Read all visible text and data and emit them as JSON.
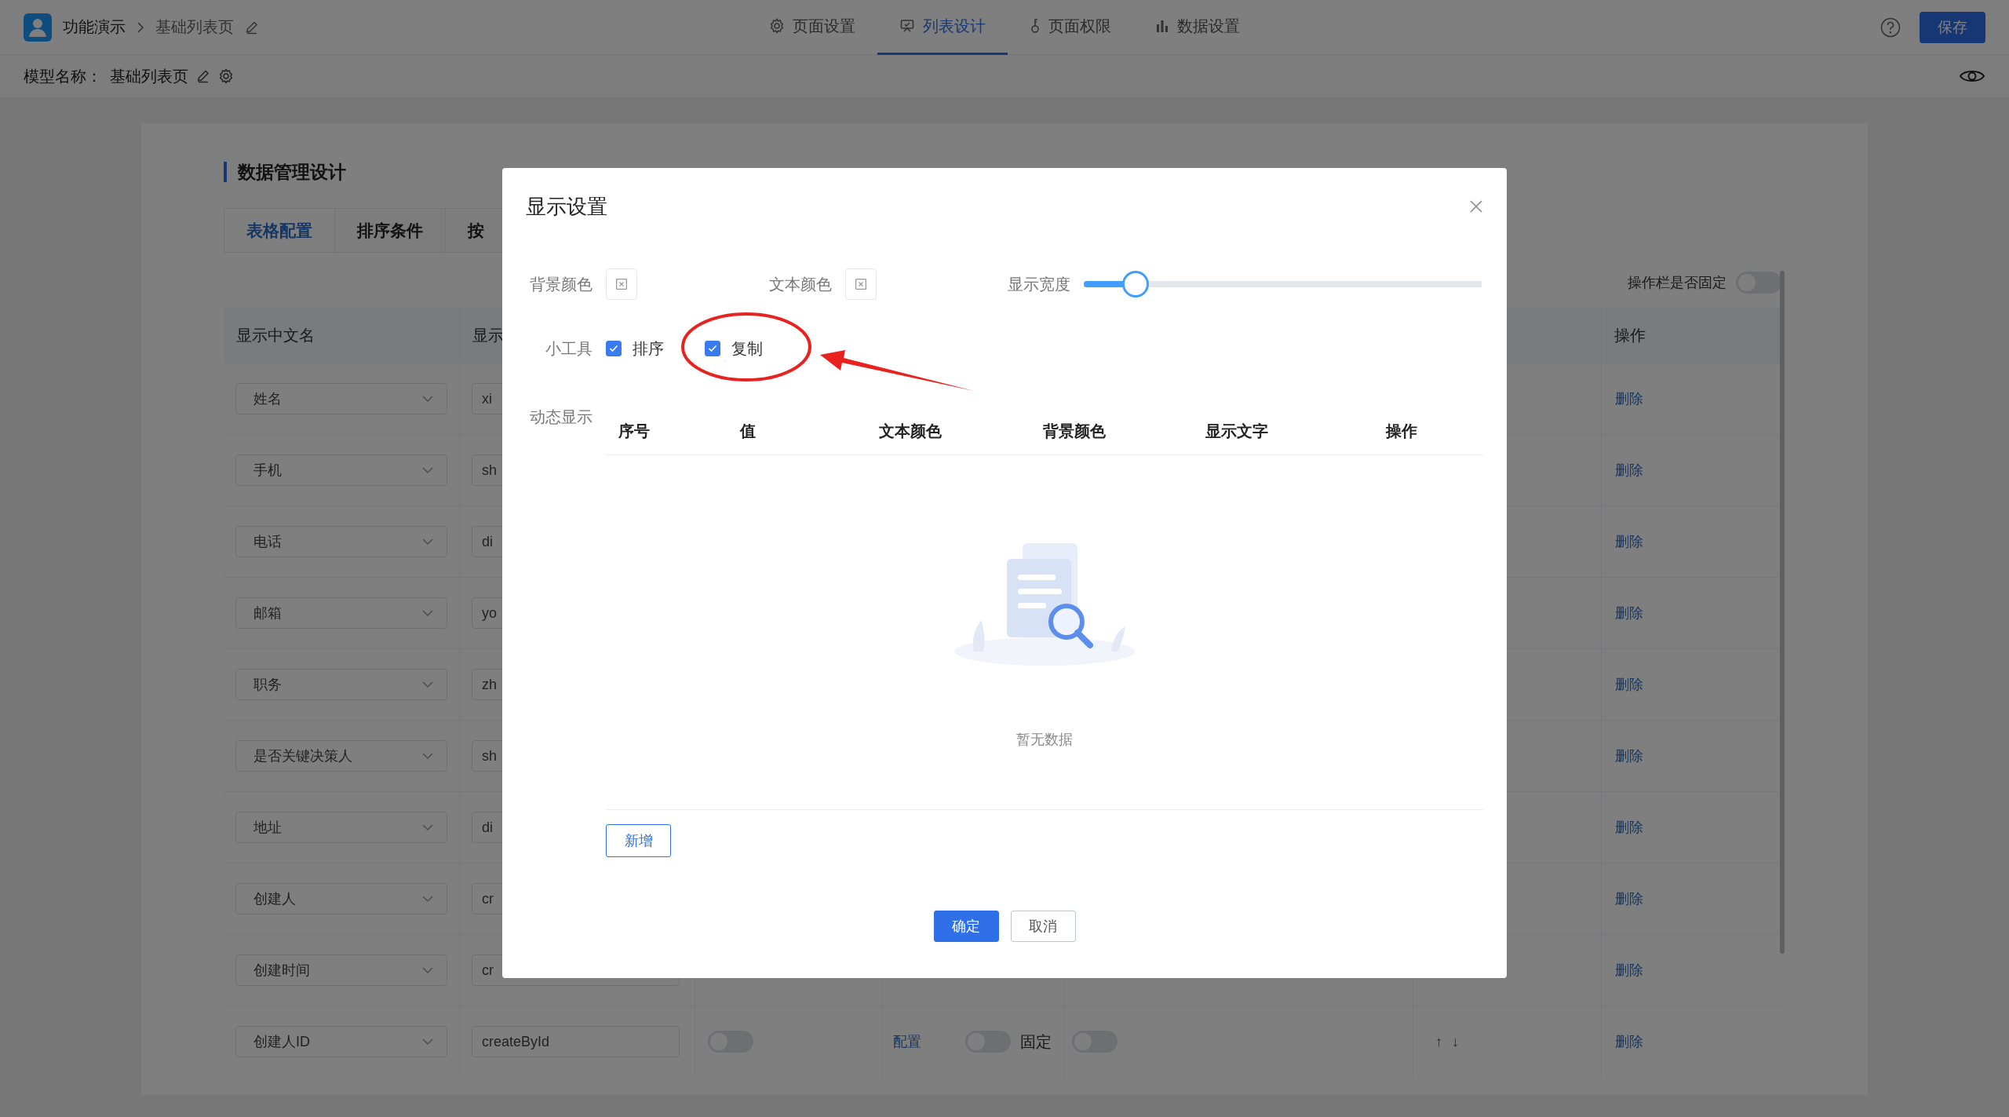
{
  "header": {
    "breadcrumb": [
      "功能演示",
      "基础列表页"
    ],
    "tabs": [
      {
        "label": "页面设置",
        "selected": false
      },
      {
        "label": "列表设计",
        "selected": true
      },
      {
        "label": "页面权限",
        "selected": false
      },
      {
        "label": "数据设置",
        "selected": false
      }
    ],
    "save_button": "保存"
  },
  "model_bar": {
    "label": "模型名称：",
    "name": "基础列表页"
  },
  "panel": {
    "title": "数据管理设计",
    "tabs": [
      {
        "label": "表格配置",
        "selected": true
      },
      {
        "label": "排序条件",
        "selected": false
      },
      {
        "label": "按",
        "selected": false
      }
    ],
    "fixed_toggle": {
      "label": "操作栏是否固定",
      "on": false
    },
    "table": {
      "columns": [
        "显示中文名",
        "显示",
        "操作"
      ],
      "rows": [
        {
          "kind": "covered",
          "name": "姓名",
          "field": "xi",
          "action": "删除"
        },
        {
          "kind": "covered",
          "name": "手机",
          "field": "sh",
          "action": "删除"
        },
        {
          "kind": "covered",
          "name": "电话",
          "field": "di",
          "action": "删除"
        },
        {
          "kind": "covered",
          "name": "邮箱",
          "field": "yo",
          "action": "删除"
        },
        {
          "kind": "covered",
          "name": "职务",
          "field": "zh",
          "action": "删除"
        },
        {
          "kind": "covered",
          "name": "是否关键决策人",
          "field": "sh",
          "action": "删除"
        },
        {
          "kind": "covered",
          "name": "地址",
          "field": "di",
          "action": "删除"
        },
        {
          "kind": "covered",
          "name": "创建人",
          "field": "cr",
          "action": "删除"
        },
        {
          "kind": "covered",
          "name": "创建时间",
          "field": "cr",
          "action": "删除"
        },
        {
          "kind": "full",
          "name": "创建人ID",
          "field": "createById",
          "switch_1_on": false,
          "link": "配置",
          "switch_2_on": false,
          "switch_2_label": "固定",
          "switch_3_on": false,
          "move_up": "↑",
          "move_down": "↓",
          "action": "删除"
        }
      ]
    }
  },
  "modal": {
    "title": "显示设置",
    "color_fields": [
      "背景颜色",
      "文本颜色"
    ],
    "width_slider": {
      "label": "显示宽度",
      "level": 0.13
    },
    "tools": {
      "label": "小工具",
      "options": [
        {
          "label": "排序",
          "checked": true
        },
        {
          "label": "复制",
          "checked": true
        }
      ]
    },
    "dynamic": {
      "label": "动态显示",
      "columns": [
        "序号",
        "值",
        "文本颜色",
        "背景颜色",
        "显示文字",
        "操作"
      ],
      "empty_text": "暂无数据",
      "add_button": "新增"
    },
    "buttons": [
      {
        "label": "确定",
        "kind": "primary"
      },
      {
        "label": "取消",
        "kind": "default"
      }
    ]
  },
  "annotations": [
    {
      "kind": "ellipse"
    },
    {
      "kind": "arrow"
    }
  ]
}
